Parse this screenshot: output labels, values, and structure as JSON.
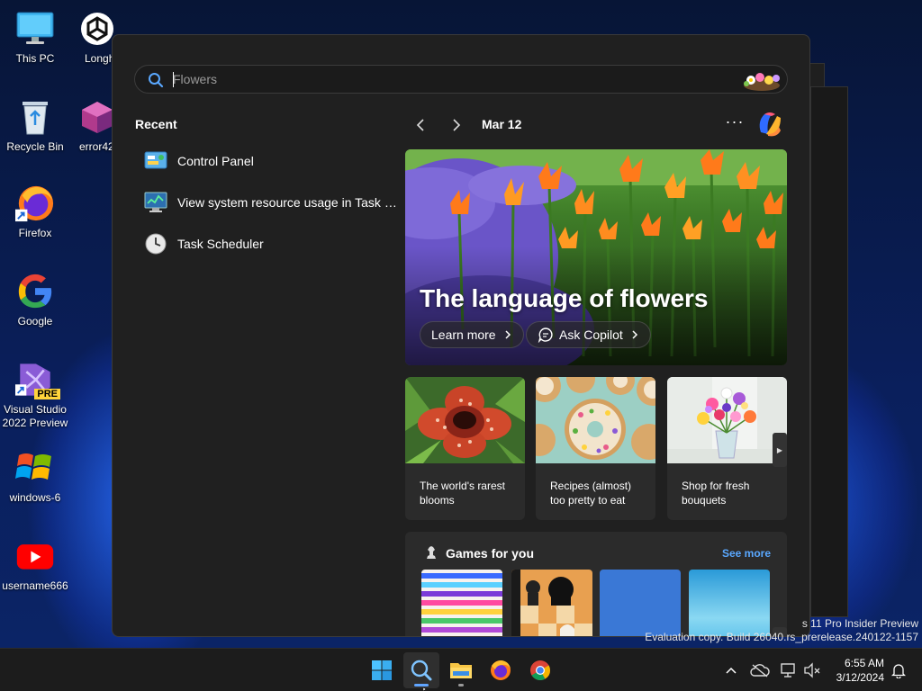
{
  "desktop": {
    "icons": [
      {
        "label": "This PC"
      },
      {
        "label": "Longh"
      },
      {
        "label": "Recycle Bin"
      },
      {
        "label": "error42"
      },
      {
        "label": "Firefox"
      },
      {
        "label": "Google"
      },
      {
        "label": "Visual Studio 2022 Preview"
      },
      {
        "label": "windows-6"
      },
      {
        "label": "username666"
      }
    ],
    "vs_badge": "PRE"
  },
  "search": {
    "placeholder": "Flowers"
  },
  "recent": {
    "title": "Recent",
    "items": [
      {
        "label": "Control Panel",
        "icon": "control-panel-icon"
      },
      {
        "label": "View system resource usage in Task Manager",
        "icon": "task-manager-icon"
      },
      {
        "label": "Task Scheduler",
        "icon": "task-scheduler-icon"
      }
    ]
  },
  "highlights": {
    "date": "Mar 12",
    "more": "···",
    "hero": {
      "title": "The language of flowers",
      "learn_more": "Learn more",
      "ask_copilot": "Ask Copilot"
    },
    "cards": [
      {
        "text": "The world's rarest blooms"
      },
      {
        "text": "Recipes (almost) too pretty to eat"
      },
      {
        "text": "Shop for fresh bouquets"
      }
    ],
    "games": {
      "title": "Games for you",
      "see_more": "See more"
    }
  },
  "watermark": {
    "line1": "s 11 Pro Insider Preview",
    "line2": "Evaluation copy. Build 26040.rs_prerelease.240122-1157"
  },
  "taskbar": {
    "time": "6:55 AM",
    "date": "3/12/2024"
  },
  "colors": {
    "accent": "#60a5ff",
    "panel_bg": "#202020",
    "card_bg": "#2b2b2b",
    "link": "#5aa8ff"
  }
}
